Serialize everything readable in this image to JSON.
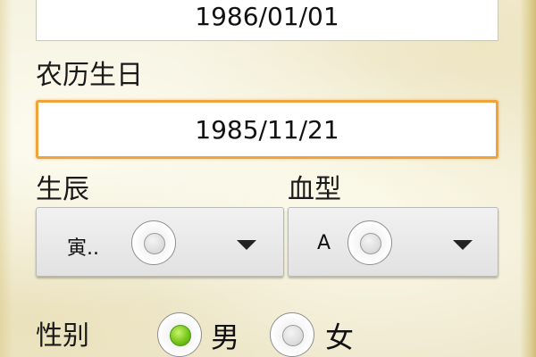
{
  "form": {
    "solar_birthday_value": "1986/01/01",
    "lunar_birthday_label": "农历生日",
    "lunar_birthday_value": "1985/11/21",
    "birth_hour_label": "生辰",
    "birth_hour_value": "寅..",
    "blood_type_label": "血型",
    "blood_type_value": "A",
    "gender_label": "性别",
    "gender_options": [
      {
        "label": "男",
        "selected": true
      },
      {
        "label": "女",
        "selected": false
      }
    ]
  },
  "icons": {
    "radio": "radio-circle-icon",
    "dropdown": "triangle-down-icon"
  },
  "colors": {
    "background": "#f3efdc",
    "focus_border": "#f0a33a",
    "radio_checked": "#76c61c"
  }
}
